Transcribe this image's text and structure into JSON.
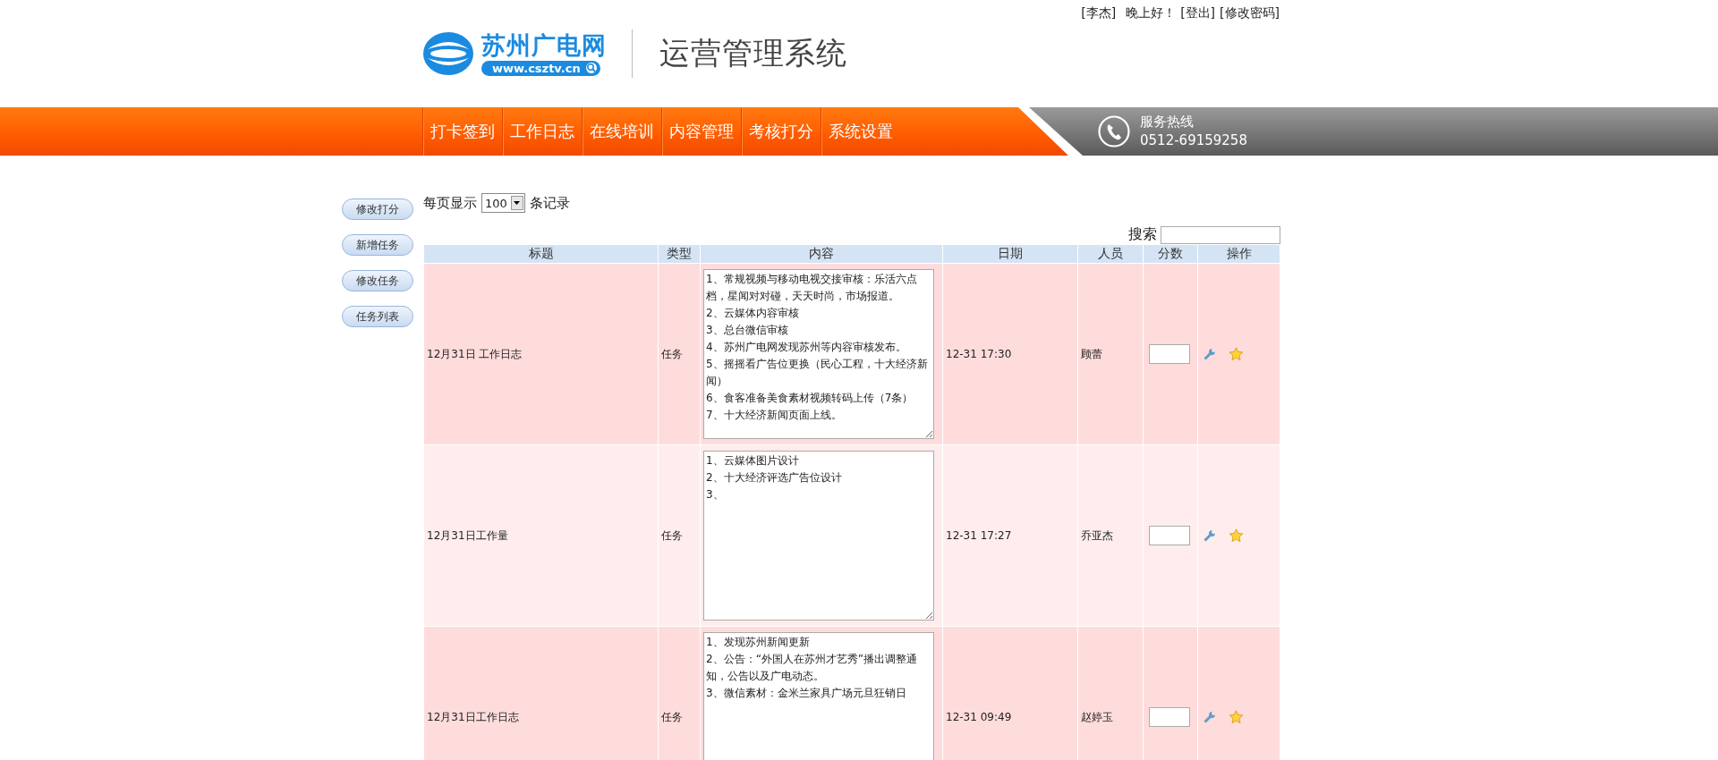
{
  "header": {
    "logo_name": "苏州广电网",
    "logo_url": "www.csztv.cn",
    "system_title": "运营管理系统",
    "user": "[李杰]",
    "greeting": "晚上好！",
    "logout": "[登出]",
    "change_password": "[修改密码]"
  },
  "nav": [
    "打卡签到",
    "工作日志",
    "在线培训",
    "内容管理",
    "考核打分",
    "系统设置"
  ],
  "hotline": {
    "label": "服务热线",
    "number": "0512-69159258"
  },
  "sidebar": [
    "修改打分",
    "新增任务",
    "修改任务",
    "任务列表"
  ],
  "page_size": {
    "prefix": "每页显示",
    "value": "100",
    "suffix": "条记录"
  },
  "search": {
    "label": "搜索"
  },
  "table": {
    "columns": [
      "标题",
      "类型",
      "内容",
      "日期",
      "人员",
      "分数",
      "操作"
    ],
    "rows": [
      {
        "title": "12月31日 工作日志",
        "type": "任务",
        "content": "1、常规视频与移动电视交接审核：乐活六点档，星闻对对碰，天天时尚，市场报道。\n2、云媒体内容审核\n3、总台微信审核\n4、苏州广电网发现苏州等内容审核发布。\n5、摇摇看广告位更换（民心工程，十大经济新闻）\n6、食客准备美食素材视频转码上传（7条）\n7、十大经济新闻页面上线。",
        "date": "12-31 17:30",
        "person": "顾蕾"
      },
      {
        "title": "12月31日工作量",
        "type": "任务",
        "content": "1、云媒体图片设计\n2、十大经济评选广告位设计\n3、",
        "date": "12-31 17:27",
        "person": "乔亚杰"
      },
      {
        "title": "12月31日工作日志",
        "type": "任务",
        "content": "1、发现苏州新闻更新\n2、公告：“外国人在苏州才艺秀”播出调整通知，公告以及广电动态。\n3、微信素材：金米兰家具广场元旦狂销日",
        "date": "12-31 09:49",
        "person": "赵婷玉"
      }
    ]
  }
}
